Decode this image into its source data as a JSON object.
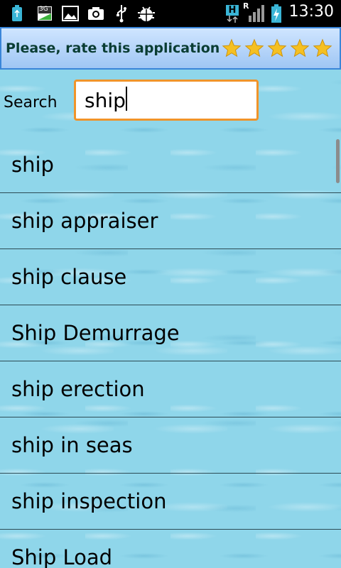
{
  "status_bar": {
    "time": "13:30",
    "icons": [
      "usb-debug-icon",
      "3g-data-icon",
      "image-icon",
      "camera-icon",
      "usb-icon",
      "android-debug-icon",
      "network-h-icon",
      "signal-icon",
      "battery-charging-icon"
    ],
    "network_label": "H",
    "roaming_label": "R",
    "tray_label": "3G"
  },
  "rate_banner": {
    "text": "Please, rate this application",
    "stars": 5,
    "star_color": "#f5c021"
  },
  "search": {
    "label": "Search",
    "value": "ship"
  },
  "results": [
    "ship",
    "ship appraiser",
    "ship clause",
    "Ship Demurrage",
    "ship erection",
    "ship in seas",
    "ship inspection",
    "Ship Load"
  ],
  "colors": {
    "accent_border": "#f0942a",
    "banner_border": "#3a86d9",
    "background_water": "#8fd6ea"
  }
}
